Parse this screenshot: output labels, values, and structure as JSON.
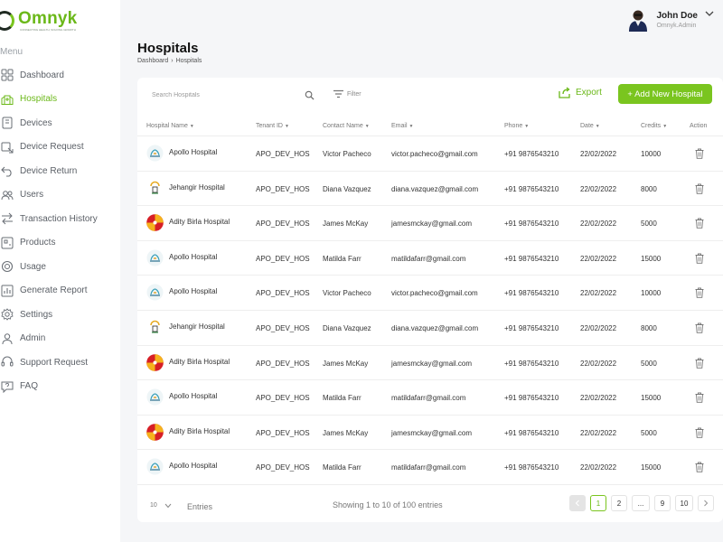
{
  "brand": {
    "name": "Omnyk",
    "tagline": "CONNECTING HEALTH, SOLVING GROWTH"
  },
  "sidebar": {
    "menu_title": "Menu",
    "items": [
      {
        "label": "Dashboard",
        "icon": "grid-icon"
      },
      {
        "label": "Hospitals",
        "icon": "hospital-icon",
        "active": true
      },
      {
        "label": "Devices",
        "icon": "device-icon"
      },
      {
        "label": "Device Request",
        "icon": "request-icon"
      },
      {
        "label": "Device Return",
        "icon": "return-icon"
      },
      {
        "label": "Users",
        "icon": "users-icon"
      },
      {
        "label": "Transaction History",
        "icon": "transaction-icon"
      },
      {
        "label": "Products",
        "icon": "products-icon"
      },
      {
        "label": "Usage",
        "icon": "usage-icon"
      },
      {
        "label": "Generate Report",
        "icon": "report-icon"
      },
      {
        "label": "Settings",
        "icon": "settings-icon"
      },
      {
        "label": "Admin",
        "icon": "admin-icon"
      },
      {
        "label": "Support Request",
        "icon": "support-icon"
      },
      {
        "label": "FAQ",
        "icon": "faq-icon"
      }
    ]
  },
  "user": {
    "name": "John Doe",
    "role": "Omnyk.Admin"
  },
  "page": {
    "title": "Hospitals",
    "breadcrumb": [
      "Dashboard",
      "Hospitals"
    ]
  },
  "toolbar": {
    "search_placeholder": "Search Hospitals",
    "filter_label": "Filter",
    "export_label": "Export",
    "add_label": "+ Add New Hospital"
  },
  "table": {
    "columns": [
      "Hospital Name",
      "Tenant ID",
      "Contact Name",
      "Email",
      "Phone",
      "Date",
      "Credits",
      "Action"
    ],
    "rows": [
      {
        "name": "Apollo Hospital",
        "logo": "apollo",
        "tenant": "APO_DEV_HOS",
        "contact": "Victor Pacheco",
        "email": "victor.pacheco@gmail.com",
        "phone": "+91 9876543210",
        "date": "22/02/2022",
        "credits": "10000"
      },
      {
        "name": "Jehangir Hospital",
        "logo": "jehangir",
        "tenant": "APO_DEV_HOS",
        "contact": "Diana Vazquez",
        "email": "diana.vazquez@gmail.com",
        "phone": "+91 9876543210",
        "date": "22/02/2022",
        "credits": "8000"
      },
      {
        "name": "Adity Birla Hospital",
        "logo": "birla",
        "tenant": "APO_DEV_HOS",
        "contact": "James McKay",
        "email": "jamesmckay@gmail.com",
        "phone": "+91 9876543210",
        "date": "22/02/2022",
        "credits": "5000"
      },
      {
        "name": "Apollo Hospital",
        "logo": "apollo",
        "tenant": "APO_DEV_HOS",
        "contact": "Matilda Farr",
        "email": "matildafarr@gmail.com",
        "phone": "+91 9876543210",
        "date": "22/02/2022",
        "credits": "15000"
      },
      {
        "name": "Apollo Hospital",
        "logo": "apollo",
        "tenant": "APO_DEV_HOS",
        "contact": "Victor Pacheco",
        "email": "victor.pacheco@gmail.com",
        "phone": "+91 9876543210",
        "date": "22/02/2022",
        "credits": "10000"
      },
      {
        "name": "Jehangir Hospital",
        "logo": "jehangir",
        "tenant": "APO_DEV_HOS",
        "contact": "Diana Vazquez",
        "email": "diana.vazquez@gmail.com",
        "phone": "+91 9876543210",
        "date": "22/02/2022",
        "credits": "8000"
      },
      {
        "name": "Adity Birla Hospital",
        "logo": "birla",
        "tenant": "APO_DEV_HOS",
        "contact": "James McKay",
        "email": "jamesmckay@gmail.com",
        "phone": "+91 9876543210",
        "date": "22/02/2022",
        "credits": "5000"
      },
      {
        "name": "Apollo Hospital",
        "logo": "apollo",
        "tenant": "APO_DEV_HOS",
        "contact": "Matilda Farr",
        "email": "matildafarr@gmail.com",
        "phone": "+91 9876543210",
        "date": "22/02/2022",
        "credits": "15000"
      },
      {
        "name": "Adity Birla Hospital",
        "logo": "birla",
        "tenant": "APO_DEV_HOS",
        "contact": "James McKay",
        "email": "jamesmckay@gmail.com",
        "phone": "+91 9876543210",
        "date": "22/02/2022",
        "credits": "5000"
      },
      {
        "name": "Apollo Hospital",
        "logo": "apollo",
        "tenant": "APO_DEV_HOS",
        "contact": "Matilda Farr",
        "email": "matildafarr@gmail.com",
        "phone": "+91 9876543210",
        "date": "22/02/2022",
        "credits": "15000"
      }
    ]
  },
  "footer": {
    "page_size": "10",
    "entries_label": "Entries",
    "showing_text": "Showing 1 to 10 of 100 entries",
    "pages": [
      "1",
      "2",
      "...",
      "9",
      "10"
    ],
    "current_page": "1"
  },
  "colors": {
    "accent": "#7ac51f",
    "accent_text": "#6bb819"
  }
}
